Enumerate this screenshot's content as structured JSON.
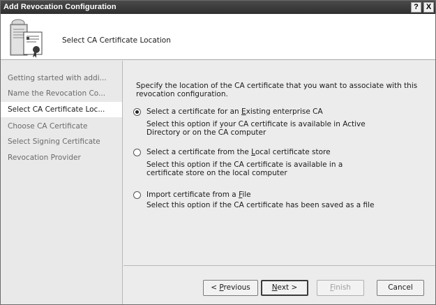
{
  "window": {
    "title": "Add Revocation Configuration",
    "help_label": "?",
    "close_label": "X"
  },
  "header": {
    "title": "Select CA Certificate Location",
    "icon": "certificate-server-icon"
  },
  "sidebar": {
    "items": [
      {
        "label": "Getting started with addi...",
        "active": false
      },
      {
        "label": "Name the Revocation Co...",
        "active": false
      },
      {
        "label": "Select CA Certificate Loc...",
        "active": true
      },
      {
        "label": "Choose CA Certificate",
        "active": false
      },
      {
        "label": "Select Signing Certificate",
        "active": false
      },
      {
        "label": "Revocation Provider",
        "active": false
      }
    ]
  },
  "main": {
    "intro": "Specify the location of the CA certificate that you want to associate with this revocation configuration.",
    "options": [
      {
        "label_pre": "Select a certificate for an ",
        "label_key": "E",
        "label_post": "xisting enterprise CA",
        "description": "Select this option if your CA certificate is available in Active Directory or on the CA computer",
        "checked": true
      },
      {
        "label_pre": "Select a certificate from the ",
        "label_key": "L",
        "label_post": "ocal certificate store",
        "description": "Select this option if the CA certificate is available in a certificate store on the local computer",
        "checked": false
      },
      {
        "label_pre": "Import certificate from a ",
        "label_key": "F",
        "label_post": "ile",
        "description": "Select this option if the CA certificate has been saved as a file",
        "checked": false
      }
    ]
  },
  "footer": {
    "previous": {
      "pre": "< ",
      "key": "P",
      "post": "revious"
    },
    "next": {
      "pre": "",
      "key": "N",
      "post": "ext >"
    },
    "finish": {
      "pre": "",
      "key": "F",
      "post": "inish"
    },
    "cancel": "Cancel"
  }
}
